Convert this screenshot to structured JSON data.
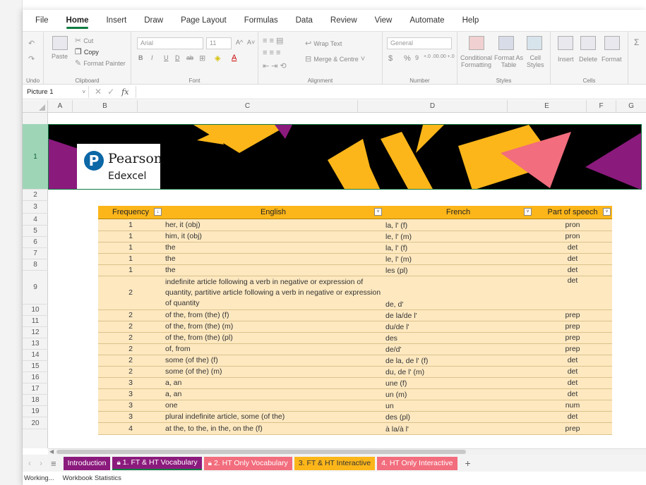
{
  "menu": [
    "File",
    "Home",
    "Insert",
    "Draw",
    "Page Layout",
    "Formulas",
    "Data",
    "Review",
    "View",
    "Automate",
    "Help"
  ],
  "ribbon": {
    "undo_group": "Undo",
    "clipboard": {
      "paste": "Paste",
      "cut": "Cut",
      "copy": "Copy",
      "format_painter": "Format Painter",
      "label": "Clipboard"
    },
    "font": {
      "name": "Arial",
      "size": "11",
      "grow": "A^",
      "shrink": "A˅",
      "bold": "B",
      "italic": "I",
      "underline": "U",
      "double_underline": "D",
      "strike": "ab",
      "label": "Font"
    },
    "alignment": {
      "wrap": "Wrap Text",
      "merge": "Merge & Centre",
      "label": "Alignment"
    },
    "number": {
      "format": "General",
      "currency": "$",
      "percent": "%",
      "comma": "9",
      "inc": "+.0 .00",
      "dec": ".00 +.0",
      "label": "Number"
    },
    "styles": {
      "conditional_1": "Conditional",
      "conditional_2": "Formatting",
      "format_table_1": "Format As",
      "format_table_2": "Table",
      "cell_styles_1": "Cell",
      "cell_styles_2": "Styles",
      "label": "Styles"
    },
    "cells": {
      "insert": "Insert",
      "delete": "Delete",
      "format": "Format",
      "label": "Cells"
    }
  },
  "formula_bar": {
    "name_box": "Picture 1",
    "fx": "fx",
    "value": ""
  },
  "columns": [
    "A",
    "B",
    "C",
    "D",
    "E",
    "F",
    "G"
  ],
  "rows": [
    "1",
    "2",
    "3",
    "4",
    "5",
    "6",
    "7",
    "8",
    "9",
    "10",
    "11",
    "12",
    "13",
    "14",
    "15",
    "16",
    "17",
    "18",
    "19",
    "20"
  ],
  "banner": {
    "logo_mark": "P",
    "logo_name": "Pearson",
    "logo_sub": "Edexcel"
  },
  "table": {
    "headers": [
      "Frequency",
      "English",
      "French",
      "Part of speech"
    ],
    "rows": [
      [
        "1",
        "her, it (obj)",
        "la, l' (f)",
        "pron"
      ],
      [
        "1",
        "him, it (obj)",
        "le, l' (m)",
        "pron"
      ],
      [
        "1",
        "the",
        "la, l' (f)",
        "det"
      ],
      [
        "1",
        "the",
        "le, l' (m)",
        "det"
      ],
      [
        "1",
        "the",
        "les (pl)",
        "det"
      ],
      [
        "2",
        "indefinite article following a verb in negative or expression of quantity, partitive article following a verb in negative or expression of quantity",
        "de, d'",
        "det"
      ],
      [
        "2",
        "of the, from (the) (f)",
        "de la/de l'",
        "prep"
      ],
      [
        "2",
        "of the, from (the) (m)",
        "du/de l'",
        "prep"
      ],
      [
        "2",
        "of the, from (the) (pl)",
        "des",
        "prep"
      ],
      [
        "2",
        "of, from",
        "de/d'",
        "prep"
      ],
      [
        "2",
        "some (of the) (f)",
        "de la, de l' (f)",
        "det"
      ],
      [
        "2",
        "some (of the) (m)",
        "du, de l' (m)",
        "det"
      ],
      [
        "3",
        "a, an",
        "une (f)",
        "det"
      ],
      [
        "3",
        "a, an",
        "un (m)",
        "det"
      ],
      [
        "3",
        "one",
        "un",
        "num"
      ],
      [
        "3",
        "plural indefinite article, some (of the)",
        "des (pl)",
        "det"
      ],
      [
        "4",
        "at the, to the, in the, on the (f)",
        "à la/à l'",
        "prep"
      ]
    ]
  },
  "sheet_tabs": [
    {
      "label": "Introduction",
      "color": "#8b1a7d",
      "lock": false
    },
    {
      "label": "1. FT & HT Vocabulary",
      "color": "#8b1a7d",
      "lock": true
    },
    {
      "label": "2. HT Only Vocabulary",
      "color": "#f26d7d",
      "lock": true
    },
    {
      "label": "3. FT & HT Interactive",
      "color": "#fcb61a",
      "lock": false
    },
    {
      "label": "4. HT Only Interactive",
      "color": "#f26d7d",
      "lock": false
    }
  ],
  "add_sheet": "+",
  "status": [
    "Working...",
    "Workbook Statistics"
  ],
  "colors": {
    "accent": "#107c41",
    "table_header": "#fcb61a",
    "table_row": "#fde8c0",
    "banner_yellow": "#fcb61a",
    "banner_purple": "#8b1a7d",
    "banner_pink": "#f26d7d"
  }
}
